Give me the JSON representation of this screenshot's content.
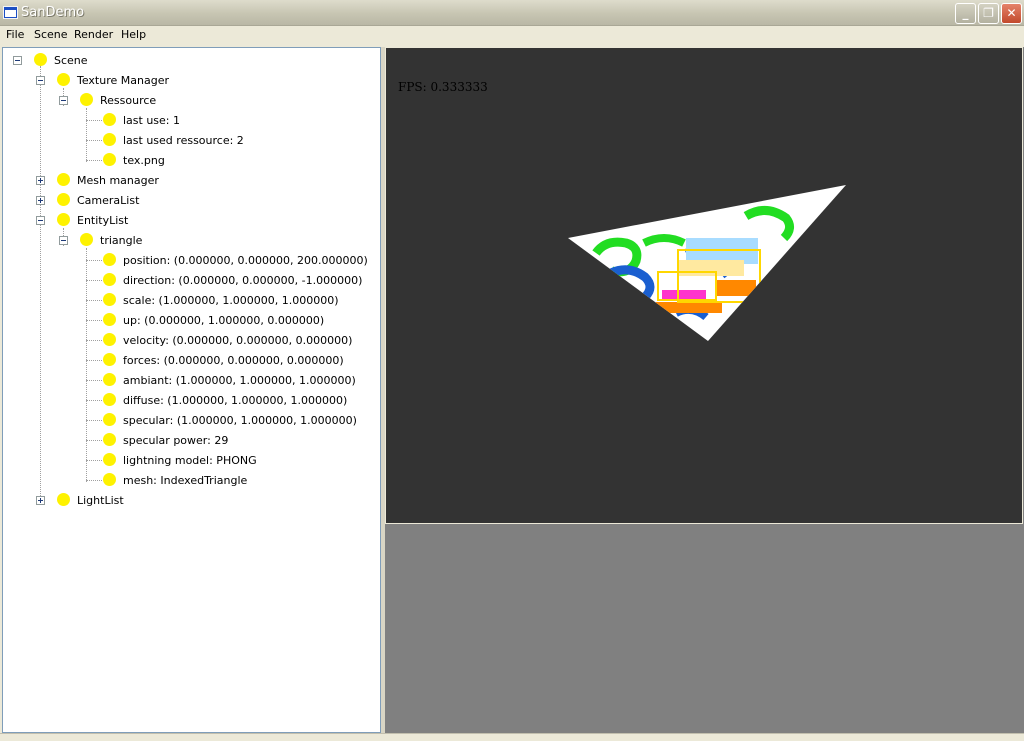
{
  "window": {
    "title": "SanDemo",
    "controls": {
      "minimize": "_",
      "maximize": "❐",
      "close": "✕"
    }
  },
  "menu": {
    "items": [
      "File",
      "Scene",
      "Render",
      "Help"
    ]
  },
  "tree": {
    "root": "Scene",
    "texture_manager": "Texture Manager",
    "ressource": "Ressource",
    "last_use": "last use: 1",
    "last_used_ressource": "last used ressource: 2",
    "tex": "tex.png",
    "mesh_manager": "Mesh manager",
    "camera_list": "CameraList",
    "entity_list": "EntityList",
    "triangle": "triangle",
    "props": [
      "position: (0.000000, 0.000000, 200.000000)",
      "direction: (0.000000, 0.000000, -1.000000)",
      "scale: (1.000000, 1.000000, 1.000000)",
      "up: (0.000000, 1.000000, 0.000000)",
      "velocity: (0.000000, 0.000000, 0.000000)",
      "forces: (0.000000, 0.000000, 0.000000)",
      "ambiant: (1.000000, 1.000000, 1.000000)",
      "diffuse: (1.000000, 1.000000, 1.000000)",
      "specular: (1.000000, 1.000000, 1.000000)",
      "specular power: 29",
      "lightning model: PHONG",
      "mesh: IndexedTriangle"
    ],
    "light_list": "LightList"
  },
  "viewport": {
    "fps": "FPS: 0.333333",
    "background": "#333333"
  },
  "colors": {
    "node_bulb": "#fef200",
    "panel_border": "#7f9db9",
    "title_bar": "#c7c5b2"
  }
}
